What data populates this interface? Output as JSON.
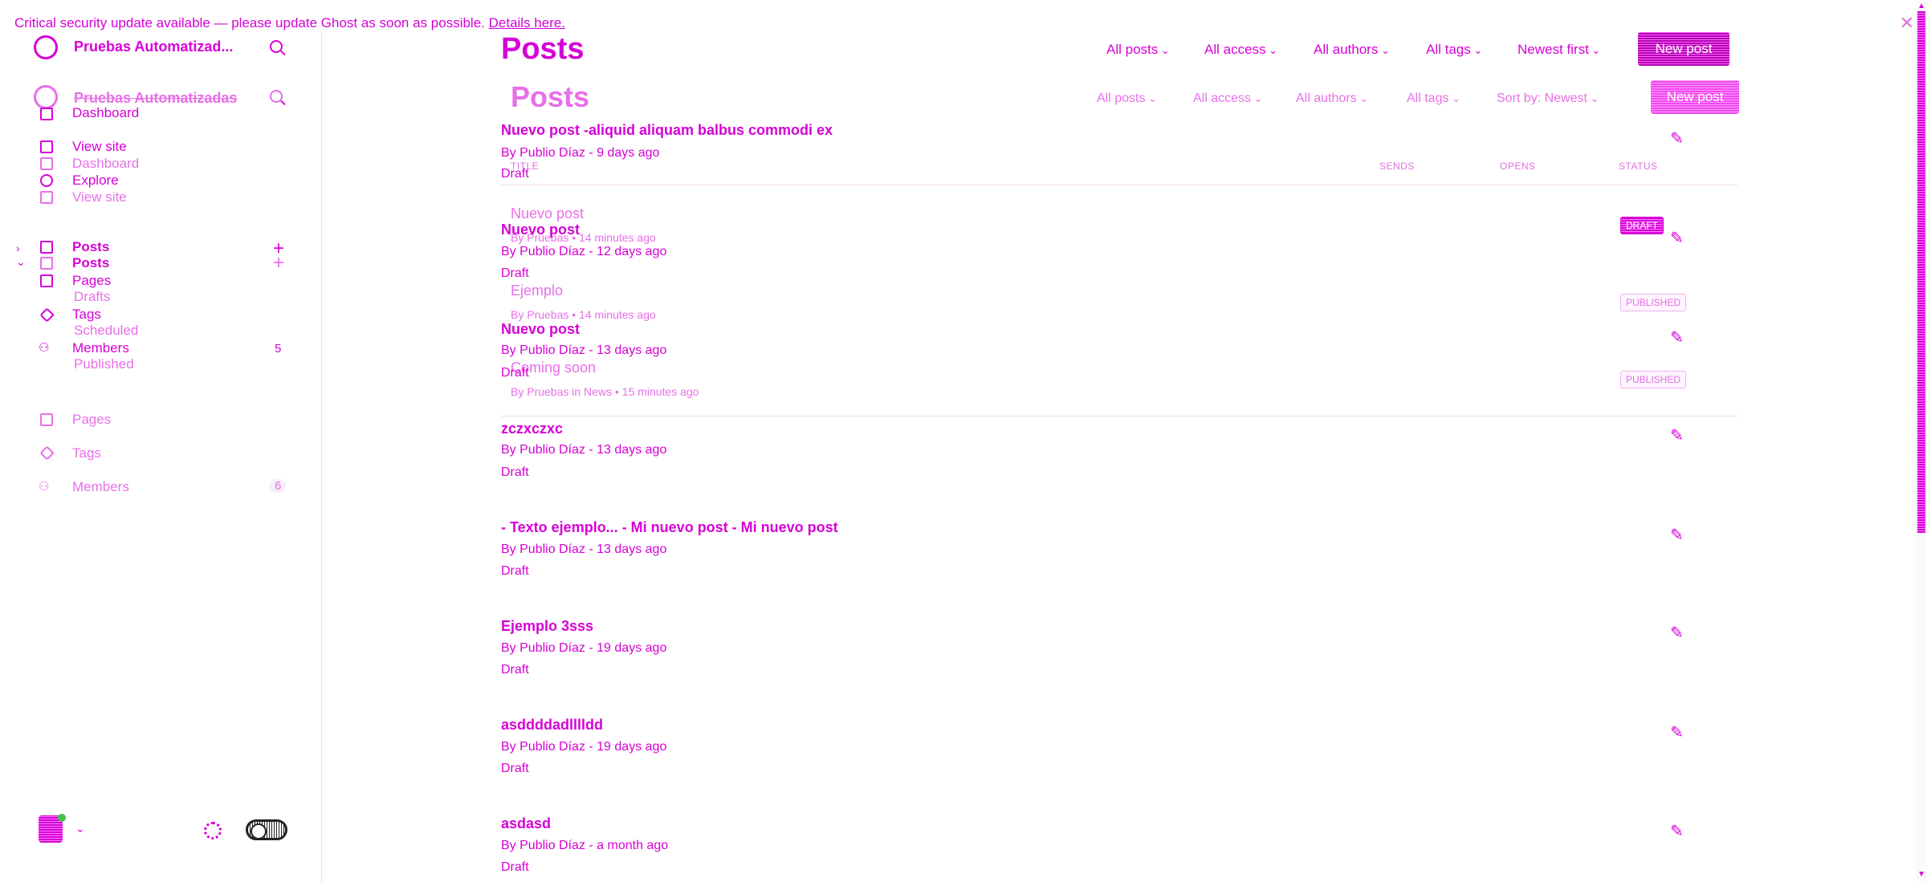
{
  "banner": {
    "text": "Critical security update available — please update Ghost as soon as possible.",
    "link": "Details here."
  },
  "sidebar": {
    "site_name": "Pruebas Automatizad...",
    "site_name_ghost": "Pruebas Automatizadas",
    "items": [
      {
        "label": "Dashboard"
      },
      {
        "label": "View site"
      },
      {
        "label": "Dashboard"
      },
      {
        "label": "Explore"
      },
      {
        "label": "View site"
      },
      {
        "label": "Posts"
      },
      {
        "label": "Posts"
      },
      {
        "label": "Pages"
      },
      {
        "label": "Drafts"
      },
      {
        "label": "Tags"
      },
      {
        "label": "Scheduled"
      },
      {
        "label": "Members"
      },
      {
        "label": "Published"
      },
      {
        "label": "Pages"
      },
      {
        "label": "Tags"
      },
      {
        "label": "Members"
      }
    ],
    "members_count": "5",
    "members_count_ghost": "6"
  },
  "header": {
    "title": "Posts",
    "filters": [
      "All posts",
      "All access",
      "All authors",
      "All tags",
      "Newest first"
    ],
    "new_post": "New post"
  },
  "ghost_header": {
    "title": "Posts",
    "filters": [
      "All posts",
      "All access",
      "All authors",
      "All tags",
      "Sort by: Newest"
    ],
    "new_post": "New post",
    "columns": [
      "TITLE",
      "SENDS",
      "OPENS",
      "STATUS"
    ]
  },
  "ghost_posts": [
    {
      "title": "Nuevo post",
      "meta": "By Pruebas • 14 minutes ago",
      "badge": "DRAFT"
    },
    {
      "title": "Ejemplo",
      "meta": "By Pruebas • 14 minutes ago",
      "badge": "PUBLISHED"
    },
    {
      "title": "Coming soon",
      "meta": "By Pruebas in News • 15 minutes ago",
      "badge": "PUBLISHED"
    }
  ],
  "posts": [
    {
      "title": "Nuevo post -aliquid aliquam balbus commodi ex",
      "meta": "By Publio Díaz - 9 days ago",
      "status": "Draft"
    },
    {
      "title": "Nuevo post",
      "meta": "By Publio Díaz - 12 days ago",
      "status": "Draft"
    },
    {
      "title": "Nuevo post",
      "meta": "By Publio Díaz - 13 days ago",
      "status": "Draft"
    },
    {
      "title": "zczxczxc",
      "meta": "By Publio Díaz - 13 days ago",
      "status": "Draft"
    },
    {
      "title": "- Texto ejemplo... - Mi nuevo post - Mi nuevo post",
      "meta": "By Publio Díaz - 13 days ago",
      "status": "Draft"
    },
    {
      "title": "Ejemplo 3sss",
      "meta": "By Publio Díaz - 19 days ago",
      "status": "Draft"
    },
    {
      "title": "asddddadlllldd",
      "meta": "By Publio Díaz - 19 days ago",
      "status": "Draft"
    },
    {
      "title": "asdasd",
      "meta": "By Publio Díaz - a month ago",
      "status": "Draft"
    }
  ],
  "icons": [
    "ghost-logo-icon",
    "search-icon",
    "home-icon",
    "globe-icon",
    "edit-icon",
    "page-icon",
    "tag-icon",
    "members-icon",
    "pencil-icon",
    "gear-icon",
    "close-icon"
  ],
  "colors": {
    "accent": "#d600d6",
    "light_accent": "#e86fe8",
    "online": "#44c24a"
  }
}
